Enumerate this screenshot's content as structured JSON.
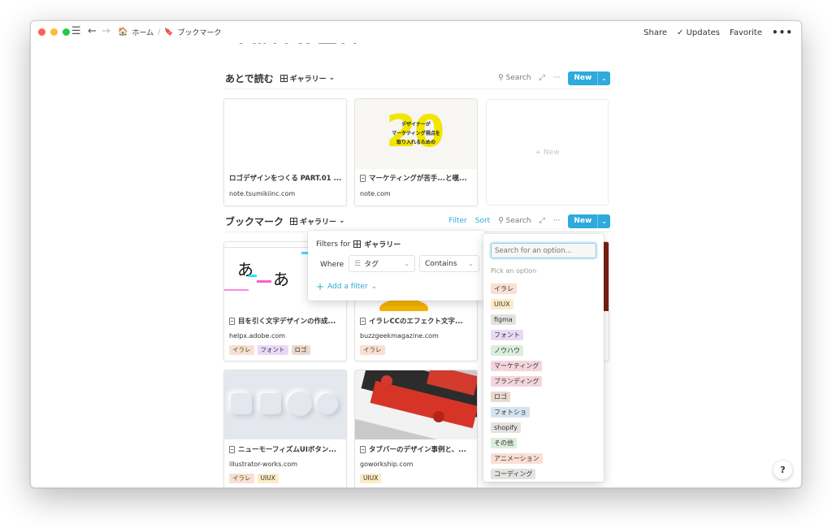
{
  "window": {
    "controls": [
      "close",
      "minimize",
      "zoom"
    ]
  },
  "breadcrumb": {
    "home": "ホーム",
    "separator": "/",
    "current": "ブックマーク"
  },
  "topbar": {
    "share": "Share",
    "updates": "Updates",
    "favorite": "Favorite",
    "more": "•••"
  },
  "page_title": "ブックマーク",
  "section1": {
    "title": "あとで読む",
    "view": "ギャラリー",
    "search": "Search",
    "new": "New",
    "cards": [
      {
        "title": "ロゴデザインをつくる PART.01 ...",
        "url": "note.tsumikiinc.com"
      },
      {
        "title": "マーケティングが苦手...と嘆...",
        "url": "note.com",
        "image_text": [
          "デザイナーが",
          "マーケティング視点を",
          "取り入れるための"
        ],
        "image_number": "20"
      }
    ],
    "new_card": "+ New"
  },
  "section2": {
    "title": "ブックマーク",
    "view": "ギャラリー",
    "filter": "Filter",
    "sort": "Sort",
    "search": "Search",
    "new": "New",
    "cards": [
      {
        "title": "目を引く文字デザインの作成...",
        "url": "helpx.adobe.com",
        "tags": [
          "イラレ",
          "フォント",
          "ロゴ"
        ]
      },
      {
        "title": "イラレCCのエフェクト文字...",
        "url": "buzzgeekmagazine.com",
        "tags": [
          "イラレ"
        ]
      },
      {
        "title": "ニューモーフィズムUIボタン...",
        "url": "illustrator-works.com",
        "tags": [
          "イラレ",
          "UIUX"
        ]
      },
      {
        "title": "タブバーのデザイン事例と、...",
        "url": "goworkship.com",
        "tags": [
          "UIUX"
        ]
      }
    ]
  },
  "filter_popup": {
    "title_prefix": "Filters for",
    "title_view": "ギャラリー",
    "where": "Where",
    "property": "タグ",
    "operator": "Contains",
    "add_filter": "Add a filter"
  },
  "option_popup": {
    "placeholder": "Search for an option...",
    "hint": "Pick an option",
    "options": [
      {
        "label": "イラレ",
        "bg": "#fadfd5"
      },
      {
        "label": "UIUX",
        "bg": "#fbecc9"
      },
      {
        "label": "figma",
        "bg": "#e3e2e0"
      },
      {
        "label": "フォント",
        "bg": "#e8d9f5"
      },
      {
        "label": "ノウハウ",
        "bg": "#dbeddb"
      },
      {
        "label": "マーケティング",
        "bg": "#f5d5dd"
      },
      {
        "label": "ブランディング",
        "bg": "#f5d5dd"
      },
      {
        "label": "ロゴ",
        "bg": "#ead9cf"
      },
      {
        "label": "フォトショ",
        "bg": "#d6e4f0"
      },
      {
        "label": "shopify",
        "bg": "#e3e2e0"
      },
      {
        "label": "その他",
        "bg": "#dbeddb"
      },
      {
        "label": "アニメーション",
        "bg": "#fadfd5"
      },
      {
        "label": "コーディング",
        "bg": "#e3e2e0"
      }
    ]
  },
  "help": "?",
  "colors": {
    "accent": "#2eaadc",
    "text": "#37352f",
    "muted": "#787774"
  }
}
